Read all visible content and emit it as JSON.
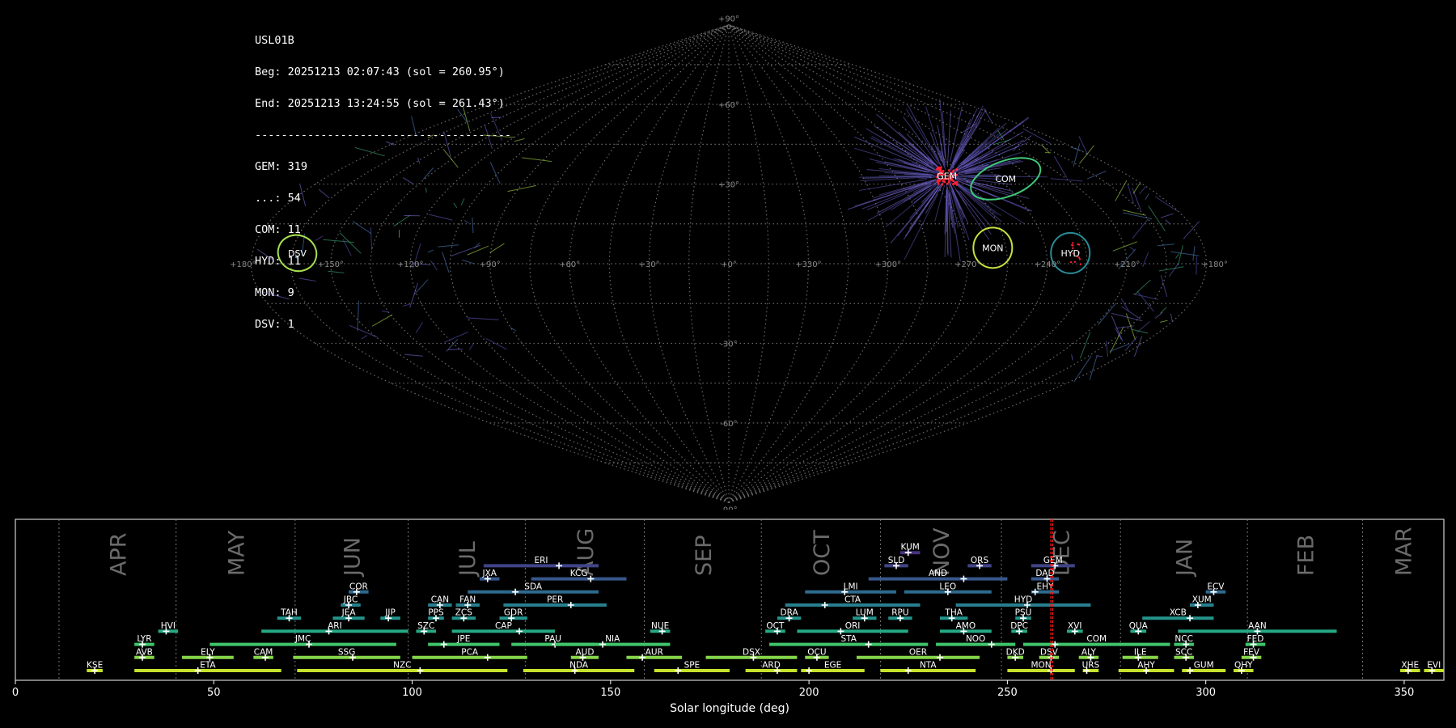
{
  "info": {
    "station": "USL01B",
    "begin": "Beg: 20251213 02:07:43 (sol = 260.95°)",
    "end": "End: 20251213 13:24:55 (sol = 261.43°)",
    "separator": "---------------------------------------",
    "counts": [
      "GEM: 319",
      "...: 54",
      "COM: 11",
      "HYD: 11",
      "MON: 9",
      "DSV: 1"
    ]
  },
  "sky_map": {
    "projection": "sinusoidal",
    "lon_labels": [
      "+180°",
      "+150°",
      "+120°",
      "+90°",
      "+60°",
      "+30°",
      "+0°",
      "+330°",
      "+300°",
      "+270°",
      "+240°",
      "+210°",
      "+180°"
    ],
    "lat_labels": [
      "+90°",
      "+60°",
      "+30°",
      "-30°",
      "-60°",
      "-90°"
    ],
    "radiants": [
      {
        "code": "COM",
        "color": "#3fc878"
      },
      {
        "code": "GEM",
        "color": "#ff2a3a"
      },
      {
        "code": "MON",
        "color": "#c6e040"
      },
      {
        "code": "HYD",
        "color": "#2a8a96"
      },
      {
        "code": "DSV",
        "color": "#a6e050"
      }
    ]
  },
  "chart_data": {
    "type": "gantt",
    "xlabel": "Solar longitude (deg)",
    "xlim": [
      0,
      360
    ],
    "xticks": [
      0,
      50,
      100,
      150,
      200,
      250,
      300,
      350
    ],
    "current_sol": [
      260.95,
      261.43
    ],
    "months": [
      {
        "label": "APR",
        "start": 11,
        "end": 40.5
      },
      {
        "label": "MAY",
        "start": 40.5,
        "end": 70.5
      },
      {
        "label": "JUN",
        "start": 70.5,
        "end": 99
      },
      {
        "label": "JUL",
        "start": 99,
        "end": 128.5
      },
      {
        "label": "AUG",
        "start": 128.5,
        "end": 158.5
      },
      {
        "label": "SEP",
        "start": 158.5,
        "end": 188
      },
      {
        "label": "OCT",
        "start": 188,
        "end": 218
      },
      {
        "label": "NOV",
        "start": 218,
        "end": 248.5
      },
      {
        "label": "DEC",
        "start": 248.5,
        "end": 278.5
      },
      {
        "label": "JAN",
        "start": 278.5,
        "end": 310.5
      },
      {
        "label": "FEB",
        "start": 310.5,
        "end": 339.5
      },
      {
        "label": "MAR",
        "start": 339.5,
        "end": 371
      }
    ],
    "showers": [
      {
        "code": "KUM",
        "row": 9,
        "start": 223,
        "end": 228,
        "peak": 225
      },
      {
        "code": "ERI",
        "row": 8,
        "start": 118,
        "end": 147,
        "peak": 137
      },
      {
        "code": "SLD",
        "row": 8,
        "start": 219,
        "end": 225,
        "peak": 222
      },
      {
        "code": "ORS",
        "row": 8,
        "start": 240,
        "end": 246,
        "peak": 243
      },
      {
        "code": "GEM",
        "row": 8,
        "start": 256,
        "end": 267,
        "peak": 262
      },
      {
        "code": "JXA",
        "row": 7,
        "start": 117,
        "end": 122,
        "peak": 119
      },
      {
        "code": "KCG",
        "row": 7,
        "start": 130,
        "end": 154,
        "peak": 145
      },
      {
        "code": "AND",
        "row": 7,
        "start": 215,
        "end": 250,
        "peak": 239
      },
      {
        "code": "DAD",
        "row": 7,
        "start": 256,
        "end": 263,
        "peak": 260
      },
      {
        "code": "COR",
        "row": 6,
        "start": 84,
        "end": 89,
        "peak": 86
      },
      {
        "code": "SDA",
        "row": 6,
        "start": 114,
        "end": 147,
        "peak": 126
      },
      {
        "code": "LMI",
        "row": 6,
        "start": 199,
        "end": 222,
        "peak": 209
      },
      {
        "code": "LEO",
        "row": 6,
        "start": 224,
        "end": 246,
        "peak": 235
      },
      {
        "code": "EHY",
        "row": 6,
        "start": 256,
        "end": 263,
        "peak": 257
      },
      {
        "code": "ECV",
        "row": 6,
        "start": 300,
        "end": 305,
        "peak": 302
      },
      {
        "code": "JBC",
        "row": 5,
        "start": 82,
        "end": 87,
        "peak": 84
      },
      {
        "code": "CAN",
        "row": 5,
        "start": 104,
        "end": 110,
        "peak": 107
      },
      {
        "code": "FAN",
        "row": 5,
        "start": 111,
        "end": 117,
        "peak": 114
      },
      {
        "code": "PER",
        "row": 5,
        "start": 123,
        "end": 149,
        "peak": 140
      },
      {
        "code": "CTA",
        "row": 5,
        "start": 194,
        "end": 228,
        "peak": 204
      },
      {
        "code": "HYD",
        "row": 5,
        "start": 237,
        "end": 271,
        "peak": 255
      },
      {
        "code": "XUM",
        "row": 5,
        "start": 296,
        "end": 302,
        "peak": 298
      },
      {
        "code": "TAH",
        "row": 4,
        "start": 66,
        "end": 72,
        "peak": 69
      },
      {
        "code": "JEA",
        "row": 4,
        "start": 80,
        "end": 88,
        "peak": 84
      },
      {
        "code": "JIP",
        "row": 4,
        "start": 92,
        "end": 97,
        "peak": 94
      },
      {
        "code": "PPS",
        "row": 4,
        "start": 104,
        "end": 108,
        "peak": 106
      },
      {
        "code": "ZCS",
        "row": 4,
        "start": 110,
        "end": 116,
        "peak": 113
      },
      {
        "code": "GDR",
        "row": 4,
        "start": 122,
        "end": 129,
        "peak": 125
      },
      {
        "code": "DRA",
        "row": 4,
        "start": 192,
        "end": 198,
        "peak": 195
      },
      {
        "code": "LUM",
        "row": 4,
        "start": 211,
        "end": 217,
        "peak": 214
      },
      {
        "code": "RPU",
        "row": 4,
        "start": 220,
        "end": 226,
        "peak": 223
      },
      {
        "code": "THA",
        "row": 4,
        "start": 233,
        "end": 240,
        "peak": 236
      },
      {
        "code": "PSU",
        "row": 4,
        "start": 252,
        "end": 256,
        "peak": 254
      },
      {
        "code": "XCB",
        "row": 4,
        "start": 284,
        "end": 302,
        "peak": 296
      },
      {
        "code": "HVI",
        "row": 3,
        "start": 36,
        "end": 41,
        "peak": 38
      },
      {
        "code": "ARI",
        "row": 3,
        "start": 62,
        "end": 99,
        "peak": 79
      },
      {
        "code": "SZC",
        "row": 3,
        "start": 101,
        "end": 106,
        "peak": 103
      },
      {
        "code": "CAP",
        "row": 3,
        "start": 110,
        "end": 136,
        "peak": 127
      },
      {
        "code": "NUE",
        "row": 3,
        "start": 160,
        "end": 165,
        "peak": 163
      },
      {
        "code": "OCT",
        "row": 3,
        "start": 189,
        "end": 194,
        "peak": 192
      },
      {
        "code": "ORI",
        "row": 3,
        "start": 197,
        "end": 225,
        "peak": 208
      },
      {
        "code": "AMO",
        "row": 3,
        "start": 233,
        "end": 246,
        "peak": 239
      },
      {
        "code": "DPC",
        "row": 3,
        "start": 251,
        "end": 255,
        "peak": 253
      },
      {
        "code": "XVI",
        "row": 3,
        "start": 265,
        "end": 269,
        "peak": 267
      },
      {
        "code": "QUA",
        "row": 3,
        "start": 281,
        "end": 285,
        "peak": 283
      },
      {
        "code": "AAN",
        "row": 3,
        "start": 293,
        "end": 333,
        "peak": 313
      },
      {
        "code": "LYR",
        "row": 2,
        "start": 30,
        "end": 35,
        "peak": 32
      },
      {
        "code": "JMC",
        "row": 2,
        "start": 49,
        "end": 96,
        "peak": 74
      },
      {
        "code": "JPE",
        "row": 2,
        "start": 104,
        "end": 122,
        "peak": 108
      },
      {
        "code": "PAU",
        "row": 2,
        "start": 125,
        "end": 146,
        "peak": 136
      },
      {
        "code": "NIA",
        "row": 2,
        "start": 136,
        "end": 165,
        "peak": 148
      },
      {
        "code": "STA",
        "row": 2,
        "start": 190,
        "end": 230,
        "peak": 215
      },
      {
        "code": "NOO",
        "row": 2,
        "start": 232,
        "end": 252,
        "peak": 246
      },
      {
        "code": "COM",
        "row": 2,
        "start": 254,
        "end": 291,
        "peak": 262
      },
      {
        "code": "NCC",
        "row": 2,
        "start": 292,
        "end": 297,
        "peak": 295
      },
      {
        "code": "FED",
        "row": 2,
        "start": 310,
        "end": 315,
        "peak": 312
      },
      {
        "code": "AVB",
        "row": 1,
        "start": 30,
        "end": 35,
        "peak": 32
      },
      {
        "code": "ELY",
        "row": 1,
        "start": 42,
        "end": 55,
        "peak": 49
      },
      {
        "code": "CAM",
        "row": 1,
        "start": 60,
        "end": 65,
        "peak": 63
      },
      {
        "code": "SSG",
        "row": 1,
        "start": 70,
        "end": 97,
        "peak": 85
      },
      {
        "code": "PCA",
        "row": 1,
        "start": 100,
        "end": 129,
        "peak": 119
      },
      {
        "code": "AUD",
        "row": 1,
        "start": 140,
        "end": 147,
        "peak": 143
      },
      {
        "code": "AUR",
        "row": 1,
        "start": 154,
        "end": 168,
        "peak": 158
      },
      {
        "code": "DSX",
        "row": 1,
        "start": 174,
        "end": 197,
        "peak": 186
      },
      {
        "code": "OCU",
        "row": 1,
        "start": 199,
        "end": 205,
        "peak": 202
      },
      {
        "code": "OER",
        "row": 1,
        "start": 212,
        "end": 243,
        "peak": 233
      },
      {
        "code": "DKD",
        "row": 1,
        "start": 250,
        "end": 254,
        "peak": 252
      },
      {
        "code": "DSV",
        "row": 1,
        "start": 258,
        "end": 263,
        "peak": 261
      },
      {
        "code": "ALY",
        "row": 1,
        "start": 268,
        "end": 273,
        "peak": 271
      },
      {
        "code": "ILE",
        "row": 1,
        "start": 279,
        "end": 288,
        "peak": 283
      },
      {
        "code": "SCC",
        "row": 1,
        "start": 292,
        "end": 297,
        "peak": 295
      },
      {
        "code": "FEV",
        "row": 1,
        "start": 309,
        "end": 314,
        "peak": 312
      },
      {
        "code": "KSE",
        "row": 0,
        "start": 18,
        "end": 22,
        "peak": 20
      },
      {
        "code": "ETA",
        "row": 0,
        "start": 30,
        "end": 67,
        "peak": 46
      },
      {
        "code": "NZC",
        "row": 0,
        "start": 71,
        "end": 124,
        "peak": 102
      },
      {
        "code": "NDA",
        "row": 0,
        "start": 128,
        "end": 156,
        "peak": 141
      },
      {
        "code": "SPE",
        "row": 0,
        "start": 161,
        "end": 180,
        "peak": 167
      },
      {
        "code": "ARD",
        "row": 0,
        "start": 184,
        "end": 197,
        "peak": 192
      },
      {
        "code": "EGE",
        "row": 0,
        "start": 198,
        "end": 214,
        "peak": 200
      },
      {
        "code": "NTA",
        "row": 0,
        "start": 218,
        "end": 242,
        "peak": 225
      },
      {
        "code": "MON",
        "row": 0,
        "start": 250,
        "end": 267,
        "peak": 261
      },
      {
        "code": "URS",
        "row": 0,
        "start": 269,
        "end": 273,
        "peak": 270
      },
      {
        "code": "AHY",
        "row": 0,
        "start": 278,
        "end": 292,
        "peak": 285
      },
      {
        "code": "GUM",
        "row": 0,
        "start": 294,
        "end": 305,
        "peak": 296
      },
      {
        "code": "QHY",
        "row": 0,
        "start": 307,
        "end": 312,
        "peak": 309
      },
      {
        "code": "XHE",
        "row": 0,
        "start": 349,
        "end": 354,
        "peak": 351
      },
      {
        "code": "EVI",
        "row": 0,
        "start": 355,
        "end": 360,
        "peak": 357
      }
    ]
  }
}
